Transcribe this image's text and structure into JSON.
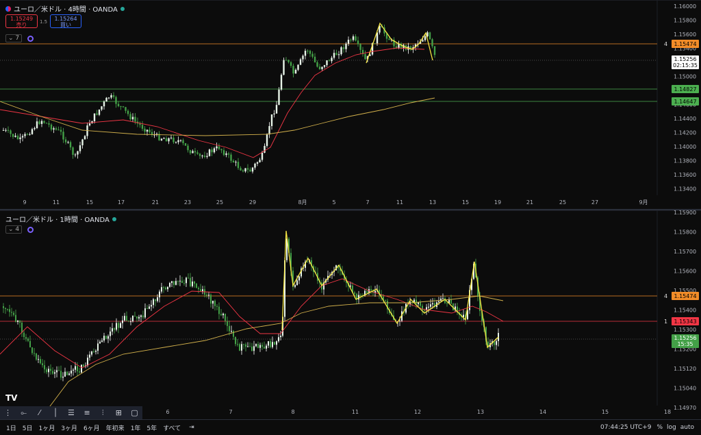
{
  "top_chart": {
    "title": "ユーロ／米ドル · 4時間 · OANDA",
    "sell_price": "1.15249",
    "sell_label": "売り",
    "buy_price": "1.15264",
    "buy_label": "買い",
    "spread": "1.5",
    "indicator_count": "7",
    "y_ticks": [
      "1.16000",
      "1.15800",
      "1.15600",
      "1.15400",
      "1.15200",
      "1.15000",
      "1.14800",
      "1.14600",
      "1.14400",
      "1.14200",
      "1.14000",
      "1.13800",
      "1.13600",
      "1.13400"
    ],
    "x_ticks": [
      "9",
      "11",
      "15",
      "17",
      "21",
      "23",
      "25",
      "29",
      "8月",
      "5",
      "7",
      "11",
      "13",
      "15",
      "19",
      "21",
      "25",
      "27",
      "9月"
    ],
    "levels": [
      {
        "num": "4",
        "price": "1.15474",
        "color": "#f28c28"
      },
      {
        "price": "1.14827",
        "color": "#4caf50"
      },
      {
        "price": "1.14647",
        "color": "#4caf50"
      }
    ],
    "current_price": "1.15256",
    "countdown": "02:15:35"
  },
  "bottom_chart": {
    "title": "ユーロ／米ドル · 1時間 · OANDA",
    "indicator_count": "4",
    "y_ticks": [
      "1.15900",
      "1.15800",
      "1.15700",
      "1.15600",
      "1.15500",
      "1.15400",
      "1.15300",
      "1.15200",
      "1.15120",
      "1.15040",
      "1.14970"
    ],
    "x_ticks": [
      "6",
      "7",
      "8",
      "11",
      "12",
      "13",
      "14",
      "15",
      "18"
    ],
    "levels": [
      {
        "num": "4",
        "price": "1.15474",
        "color": "#f28c28"
      },
      {
        "num": "1",
        "price": "1.15343",
        "color": "#f23645"
      }
    ],
    "current_price": "1.15256",
    "countdown": "15:35"
  },
  "toolbar": {
    "tools": [
      "cursor-line-icon",
      "trendline-icon",
      "vertical-line-icon",
      "fib-icon",
      "channel-icon",
      "parallel-icon",
      "grid-icon",
      "rect-icon"
    ]
  },
  "bottom_bar": {
    "ranges": [
      "1日",
      "5日",
      "1ヶ月",
      "3ヶ月",
      "6ヶ月",
      "年初来",
      "1年",
      "5年",
      "すべて"
    ],
    "clock": "07:44:25 UTC+9"
  }
}
